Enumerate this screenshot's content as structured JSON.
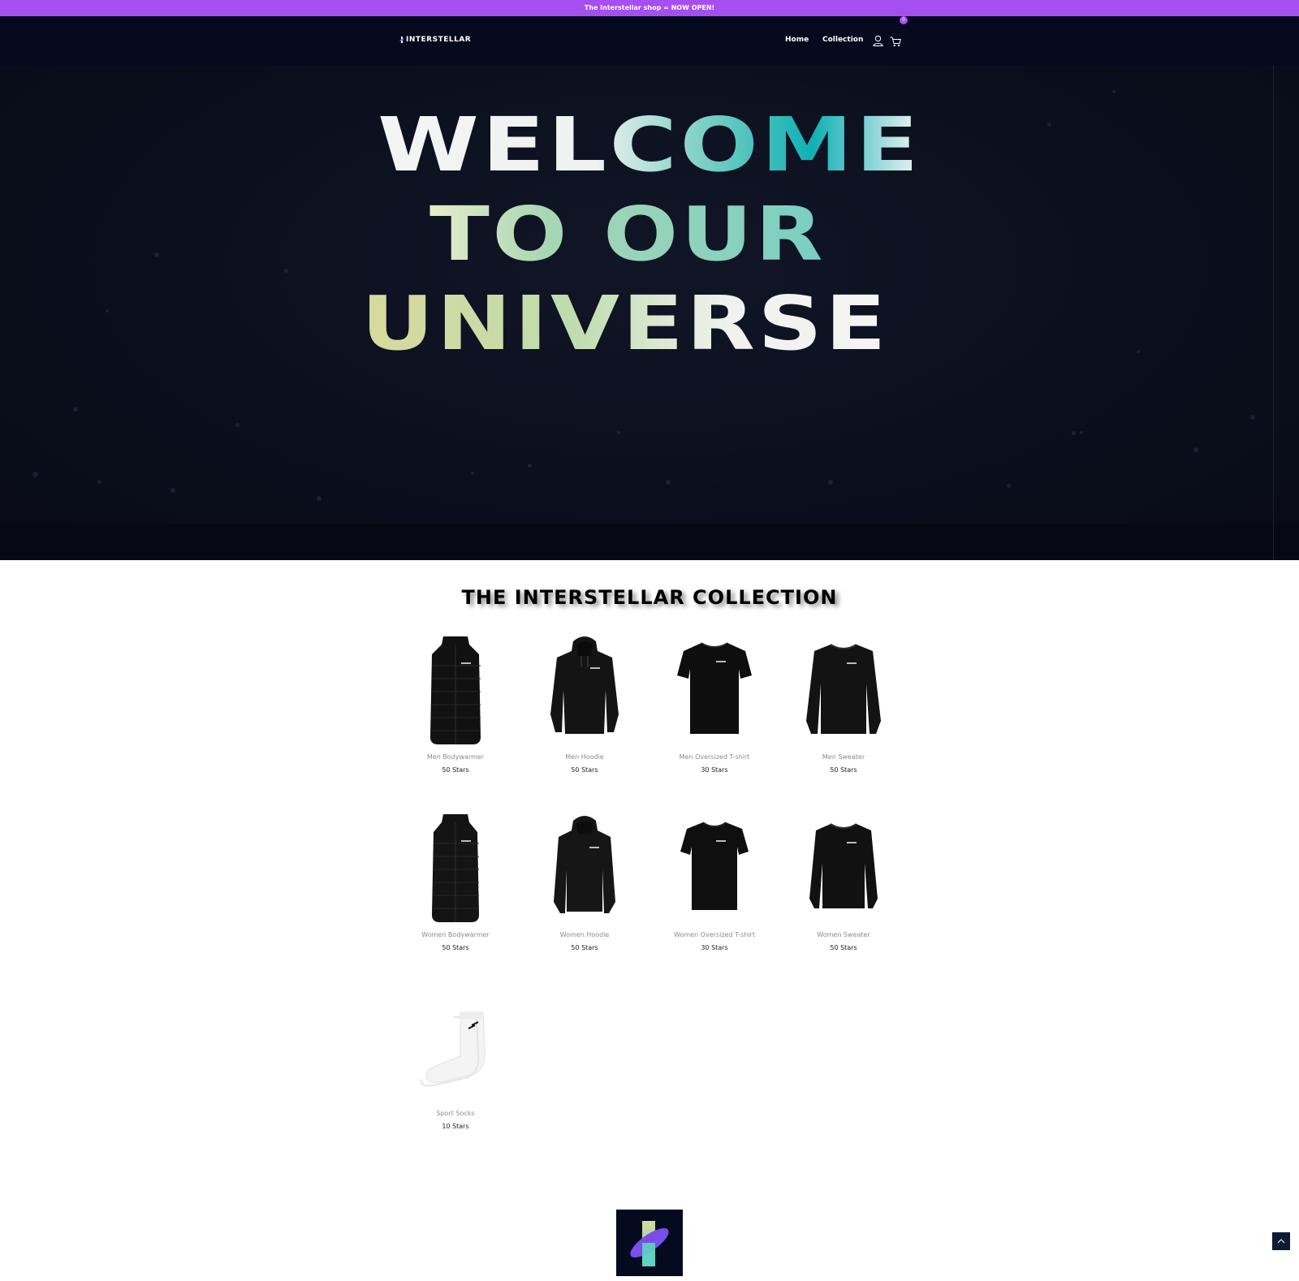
{
  "announcement": {
    "text": "The Interstellar shop = NOW OPEN!"
  },
  "header": {
    "logo_text": "INTERSTELLAR",
    "nav": [
      {
        "label": "Home"
      },
      {
        "label": "Collection"
      }
    ],
    "account_icon": "user-icon",
    "cart_icon": "cart-icon",
    "cart_count": "0"
  },
  "hero": {
    "lines": [
      "WELCOME",
      "TO OUR",
      "UNIVERSE"
    ]
  },
  "collection": {
    "title": "THE INTERSTELLAR COLLECTION",
    "products": [
      {
        "name": "Men Bodywarmer",
        "price": "50 Stars",
        "type": "vest"
      },
      {
        "name": "Men Hoodie",
        "price": "50 Stars",
        "type": "hoodie"
      },
      {
        "name": "Men Oversized T-shirt",
        "price": "30 Stars",
        "type": "tshirt"
      },
      {
        "name": "Men Sweater",
        "price": "50 Stars",
        "type": "sweater"
      },
      {
        "name": "Women Bodywarmer",
        "price": "50 Stars",
        "type": "vest"
      },
      {
        "name": "Women Hoodie",
        "price": "50 Stars",
        "type": "hoodie"
      },
      {
        "name": "Women Oversized T-shirt",
        "price": "30 Stars",
        "type": "tshirt"
      },
      {
        "name": "Women Sweater",
        "price": "50 Stars",
        "type": "sweater"
      },
      {
        "name": "Sport Socks",
        "price": "10 Stars",
        "type": "socks"
      }
    ]
  },
  "colors": {
    "accent": "#a64ff0",
    "header_bg": "#050a1e",
    "hero_bg": "#0b0f1d",
    "footer_logo_bg": "#040a1f"
  },
  "footer": {
    "logo_icon": "interstellar-logo-icon"
  },
  "scroll_top_icon": "chevron-up-icon"
}
